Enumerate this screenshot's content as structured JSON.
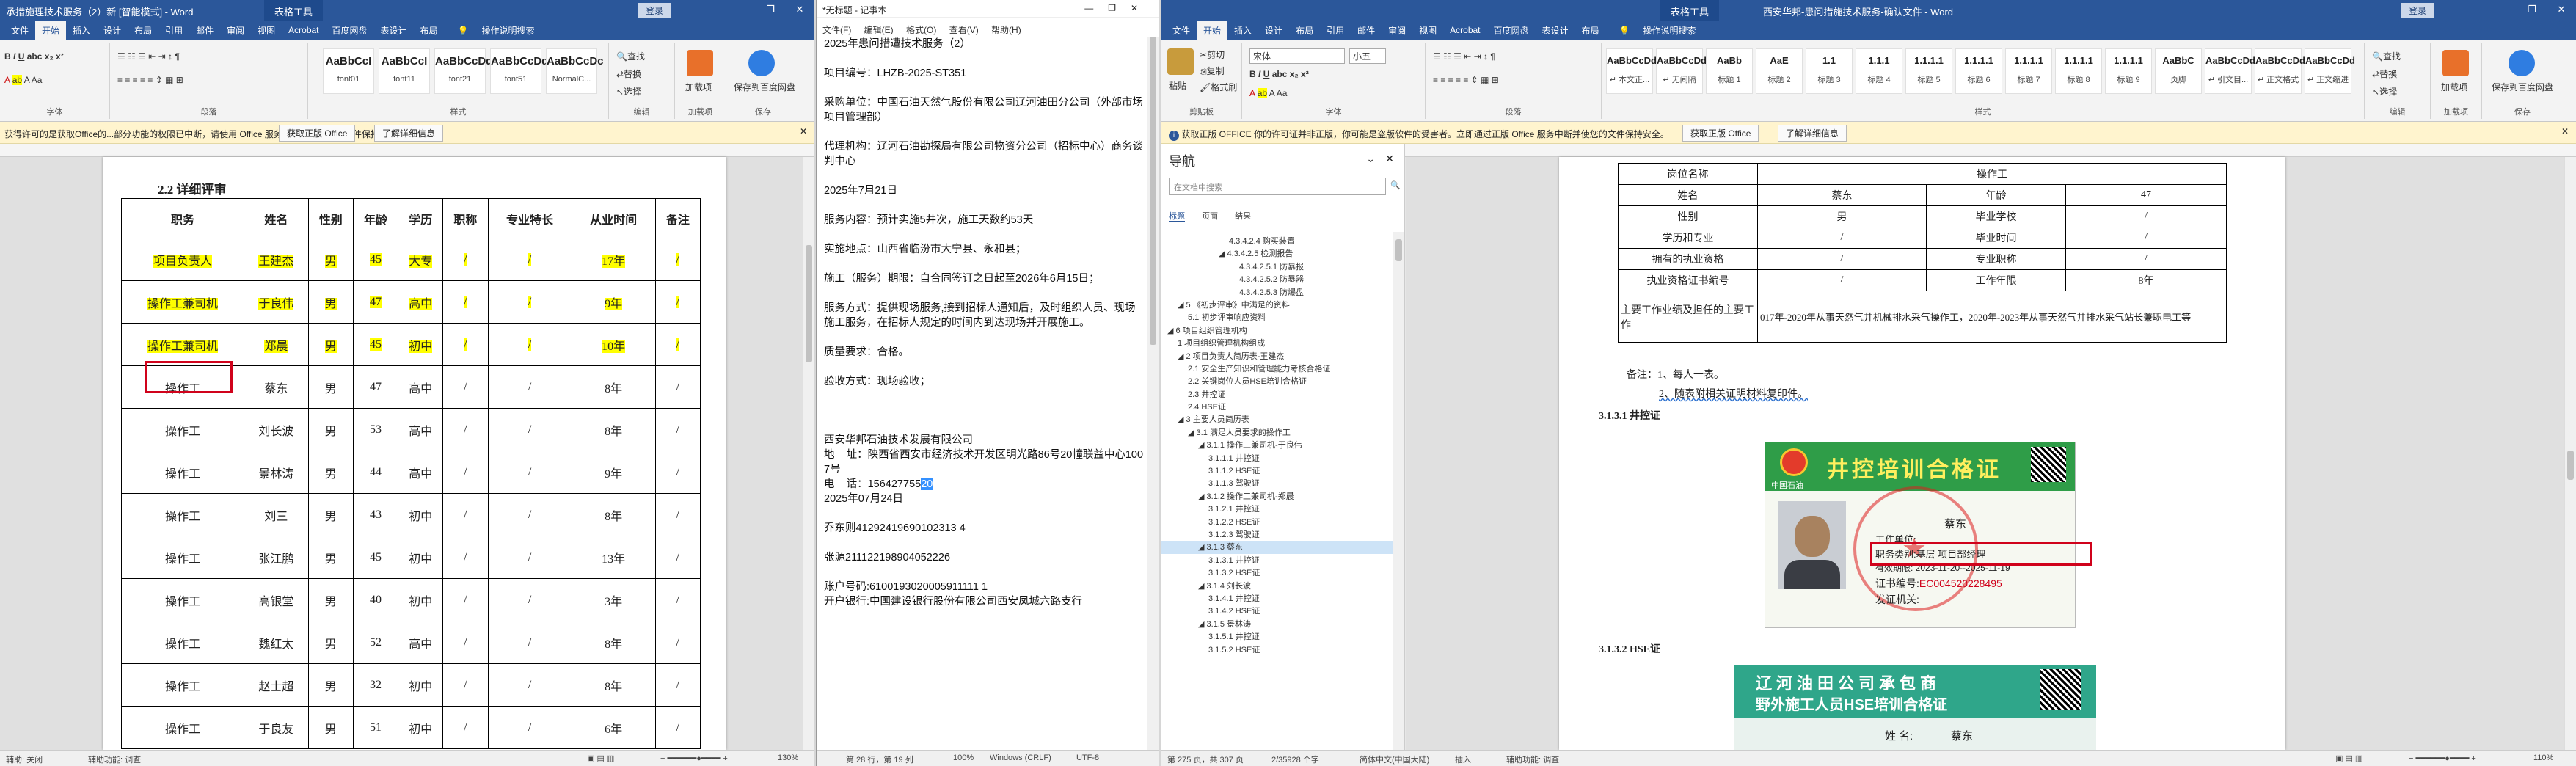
{
  "word1": {
    "title": "承措施理技术服务（2）新 [智能模式] - Word",
    "context_tab": "表格工具",
    "login": "登录",
    "tabs": [
      "文件",
      "开始",
      "插入",
      "设计",
      "布局",
      "引用",
      "邮件",
      "审阅",
      "视图",
      "Acrobat",
      "百度网盘",
      "表设计",
      "布局",
      "操作说明搜索"
    ],
    "styles": [
      {
        "sample": "AaBbCcI",
        "name": "font01"
      },
      {
        "sample": "AaBbCcI",
        "name": "font11"
      },
      {
        "sample": "AaBbCcDd",
        "name": "font21"
      },
      {
        "sample": "AaBbCcDd",
        "name": "font51"
      },
      {
        "sample": "AaBbCcDc",
        "name": "NormalC..."
      }
    ],
    "groups": [
      "字体",
      "段落",
      "样式",
      "编辑",
      "加载项",
      "保存"
    ],
    "edit": [
      "查找",
      "替换",
      "选择"
    ],
    "addins": [
      "加载项"
    ],
    "save": "保存到百度网盘",
    "msg": "获得许可的是获取Office的...部分功能的权限已中断，请使用 Office 服务中断开并使您的文件保持安全。",
    "msg_btn1": "获取正版 Office",
    "msg_btn2": "了解详细信息",
    "heading": "2.2 详细评审",
    "table_header": [
      "职务",
      "姓名",
      "性别",
      "年龄",
      "学历",
      "职称",
      "专业特长",
      "从业时间",
      "备注"
    ],
    "rows": [
      [
        "项目负责人",
        "王建杰",
        "男",
        "45",
        "大专",
        "/",
        "/",
        "17年",
        "/"
      ],
      [
        "操作工兼司机",
        "于良伟",
        "男",
        "47",
        "高中",
        "/",
        "/",
        "9年",
        "/"
      ],
      [
        "操作工兼司机",
        "郑晨",
        "男",
        "45",
        "初中",
        "/",
        "/",
        "10年",
        "/"
      ],
      [
        "操作工",
        "蔡东",
        "男",
        "47",
        "高中",
        "/",
        "/",
        "8年",
        "/"
      ],
      [
        "操作工",
        "刘长波",
        "男",
        "53",
        "高中",
        "/",
        "/",
        "8年",
        "/"
      ],
      [
        "操作工",
        "景林涛",
        "男",
        "44",
        "高中",
        "/",
        "/",
        "9年",
        "/"
      ],
      [
        "操作工",
        "刘三",
        "男",
        "43",
        "初中",
        "/",
        "/",
        "8年",
        "/"
      ],
      [
        "操作工",
        "张江鹏",
        "男",
        "45",
        "初中",
        "/",
        "/",
        "13年",
        "/"
      ],
      [
        "操作工",
        "高银堂",
        "男",
        "40",
        "初中",
        "/",
        "/",
        "3年",
        "/"
      ],
      [
        "操作工",
        "魏红太",
        "男",
        "52",
        "高中",
        "/",
        "/",
        "8年",
        "/"
      ],
      [
        "操作工",
        "赵士超",
        "男",
        "32",
        "初中",
        "/",
        "/",
        "8年",
        "/"
      ],
      [
        "操作工",
        "于良友",
        "男",
        "51",
        "初中",
        "/",
        "/",
        "6年",
        "/"
      ]
    ],
    "status_left": "辅助: 关闭",
    "status_a11y": "辅助功能: 调查",
    "zoom": "130%"
  },
  "notepad": {
    "title": "*无标题 - 记事本",
    "menu": [
      "文件(F)",
      "编辑(E)",
      "格式(O)",
      "查看(V)",
      "帮助(H)"
    ],
    "lines": [
      "2025年患问措遭技术服务（2）",
      "",
      "项目编号：LHZB-2025-ST351",
      "",
      "采购单位：中国石油天然气股份有限公司辽河油田分公司（外部市场项目管理部）",
      "",
      "代理机构：辽河石油勘探局有限公司物资分公司（招标中心）商务谈判中心",
      "",
      "2025年7月21日",
      "",
      "服务内容：预计实施5井次，施工天数约53天",
      "",
      "实施地点：山西省临汾市大宁县、永和县；",
      "",
      "施工（服务）期限：自合同签订之日起至2026年6月15日；",
      "",
      "服务方式：提供现场服务,接到招标人通知后，及时组织人员、现场施工服务，在招标人规定的时间内到达现场并开展施工。",
      "",
      "质量要求：合格。",
      "",
      "验收方式：现场验收；",
      "",
      "",
      "",
      "西安华邦石油技术发展有限公司",
      "地    址：陕西省西安市经济技术开发区明光路86号20幢联益中心1007号",
      "电    话：15642775520",
      "2025年07月24日",
      "",
      "乔东则41292419690102313 4",
      "",
      "张源211122198904052226",
      "",
      "账户号码:6100193020005911111 1",
      "开户银行:中国建设银行股份有限公司西安凤城六路支行"
    ],
    "status": [
      "第 28 行，第 19 列",
      "100%",
      "Windows (CRLF)",
      "UTF-8"
    ]
  },
  "word2": {
    "title": "西安华邦-患问措施技术服务-确认文件 - Word",
    "context_tab": "表格工具",
    "login": "登录",
    "tabs": [
      "文件",
      "开始",
      "插入",
      "设计",
      "布局",
      "引用",
      "邮件",
      "审阅",
      "视图",
      "Acrobat",
      "百度网盘",
      "表设计",
      "布局",
      "操作说明搜索"
    ],
    "clipboard": [
      "剪切",
      "复制",
      "格式刷"
    ],
    "paste": "粘贴",
    "font_name": "宋体",
    "font_size": "小五",
    "styles": [
      {
        "sample": "AaBbCcDd",
        "name": "↵ 本文正..."
      },
      {
        "sample": "AaBbCcDd",
        "name": "↵ 无间隔"
      },
      {
        "sample": "AaBb",
        "name": "标题 1"
      },
      {
        "sample": "AaE",
        "name": "标题 2"
      },
      {
        "sample": "1.1",
        "name": "标题 3"
      },
      {
        "sample": "1.1.1",
        "name": "标题 4"
      },
      {
        "sample": "1.1.1.1",
        "name": "标题 5"
      },
      {
        "sample": "1.1.1.1",
        "name": "标题 6"
      },
      {
        "sample": "1.1.1.1",
        "name": "标题 7"
      },
      {
        "sample": "1.1.1.1",
        "name": "标题 8"
      },
      {
        "sample": "1.1.1.1",
        "name": "标题 9"
      },
      {
        "sample": "AaBbC",
        "name": "页脚"
      },
      {
        "sample": "AaBbCcDd",
        "name": "↵ 引文目..."
      },
      {
        "sample": "AaBbCcDd",
        "name": "↵ 正文格式"
      },
      {
        "sample": "AaBbCcDd",
        "name": "↵ 正文缩进"
      }
    ],
    "groups": [
      "剪贴板",
      "字体",
      "段落",
      "样式",
      "编辑",
      "加载项",
      "保存"
    ],
    "msg": "获取正版 OFFICE  你的许可证并非正版，你可能是盗版软件的受害者。立即通过正版 Office 服务中断并使您的文件保持安全。",
    "msg_btn1": "获取正版 Office",
    "msg_btn2": "了解详细信息",
    "nav": {
      "title": "导航",
      "search": "在文档中搜索",
      "tabs": [
        "标题",
        "页面",
        "结果"
      ],
      "items": [
        {
          "t": "4.3.4.2.4 购买装置",
          "d": 6
        },
        {
          "t": "◢ 4.3.4.2.5 检测报告",
          "d": 5
        },
        {
          "t": "4.3.4.2.5.1 防暴报",
          "d": 7
        },
        {
          "t": "4.3.4.2.5.2 防暴器",
          "d": 7
        },
        {
          "t": "4.3.4.2.5.3 防爆盘",
          "d": 7
        },
        {
          "t": "◢ 5 《初步评审》中满足的资料",
          "d": 1
        },
        {
          "t": "5.1 初步评审响应资料",
          "d": 2
        },
        {
          "t": "◢ 6 项目组织管理机构",
          "d": 0
        },
        {
          "t": "1 项目组织管理机构组成",
          "d": 1
        },
        {
          "t": "◢ 2 项目负责人简历表-王建杰",
          "d": 1
        },
        {
          "t": "2.1 安全生产知识和管理能力考核合格证",
          "d": 2
        },
        {
          "t": "2.2 关键岗位人员HSE培训合格证",
          "d": 2
        },
        {
          "t": "2.3 井控证",
          "d": 2
        },
        {
          "t": "2.4 HSE证",
          "d": 2
        },
        {
          "t": "◢ 3 主要人员简历表",
          "d": 1
        },
        {
          "t": "◢ 3.1 满足人员要求的操作工",
          "d": 2
        },
        {
          "t": "◢ 3.1.1 操作工兼司机-于良伟",
          "d": 3
        },
        {
          "t": "3.1.1.1 井控证",
          "d": 4
        },
        {
          "t": "3.1.1.2 HSE证",
          "d": 4
        },
        {
          "t": "3.1.1.3 驾驶证",
          "d": 4
        },
        {
          "t": "◢ 3.1.2 操作工兼司机-郑晨",
          "d": 3
        },
        {
          "t": "3.1.2.1 井控证",
          "d": 4
        },
        {
          "t": "3.1.2.2 HSE证",
          "d": 4
        },
        {
          "t": "3.1.2.3 驾驶证",
          "d": 4
        },
        {
          "t": "◢ 3.1.3 蔡东",
          "d": 3,
          "cur": true
        },
        {
          "t": "3.1.3.1 井控证",
          "d": 4
        },
        {
          "t": "3.1.3.2 HSE证",
          "d": 4
        },
        {
          "t": "◢ 3.1.4 刘长波",
          "d": 3
        },
        {
          "t": "3.1.4.1 井控证",
          "d": 4
        },
        {
          "t": "3.1.4.2 HSE证",
          "d": 4
        },
        {
          "t": "◢ 3.1.5 景林涛",
          "d": 3
        },
        {
          "t": "3.1.5.1 井控证",
          "d": 4
        },
        {
          "t": "3.1.5.2 HSE证",
          "d": 4
        }
      ]
    },
    "form": [
      [
        "岗位名称",
        "操作工"
      ],
      [
        "姓名",
        "蔡东",
        "年龄",
        "47"
      ],
      [
        "性别",
        "男",
        "毕业学校",
        "/"
      ],
      [
        "学历和专业",
        "/",
        "毕业时间",
        "/"
      ],
      [
        "拥有的执业资格",
        "/",
        "专业职称",
        "/"
      ],
      [
        "执业资格证书编号",
        "/",
        "工作年限",
        "8年"
      ]
    ],
    "work_label": "主要工作业绩及担任的主要工作",
    "work_text": "017年-2020年从事天然气井机械排水采气操作工，2020年-2023年从事天然气井排水采气站长兼职电工等",
    "note1": "备注：1、每人一表。",
    "note2": "2、随表附相关证明材料复印件。",
    "h1": "3.1.3.1 井控证",
    "h2": "3.1.3.2 HSE证",
    "card1": {
      "title": "井控培训合格证",
      "company": "中国石油",
      "name": "蔡东",
      "line1": "工作单位:",
      "line2": "职务类别:基层  项目部经理",
      "line3": "有效期限: 2023-11-20--2025-11-19",
      "cert_label": "证书编号:",
      "cert": "EC004520228495",
      "issuer": "发证机关:"
    },
    "card2": {
      "title": "辽河油田公司承包商",
      "subtitle": "野外施工人员HSE培训合格证",
      "name_label": "姓  名:",
      "name": "蔡东"
    },
    "status_left": "第 275 页，共 307 页",
    "status_words": "2/35928 个字",
    "status_lang": "简体中文(中国大陆)",
    "status_mode": "插入",
    "status_a11y": "辅助功能: 调查",
    "zoom": "110%"
  }
}
